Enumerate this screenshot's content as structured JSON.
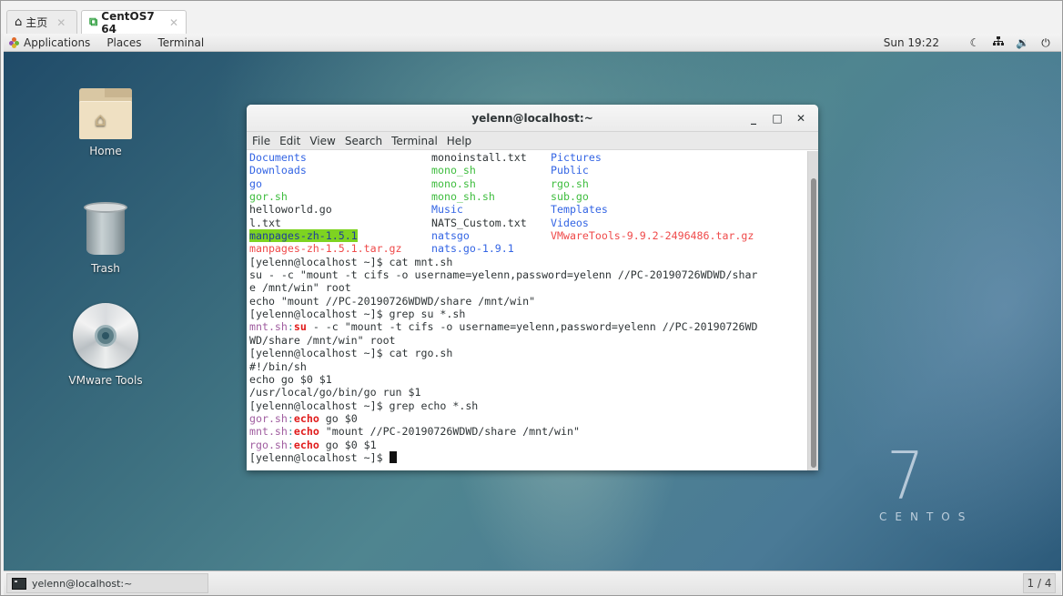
{
  "host_tabs": [
    {
      "icon": "home-icon",
      "label": "主页",
      "active": false
    },
    {
      "icon": "vm-icon",
      "label": "CentOS7 64",
      "active": true
    }
  ],
  "topbar": {
    "menus": [
      "Applications",
      "Places",
      "Terminal"
    ],
    "clock": "Sun 19:22",
    "tray_icons": [
      "night-light-icon",
      "network-icon",
      "volume-icon",
      "power-icon"
    ]
  },
  "desktop_icons": [
    {
      "label": "Home",
      "icon": "home-folder-icon"
    },
    {
      "label": "Trash",
      "icon": "trash-icon"
    },
    {
      "label": "VMware Tools",
      "icon": "disc-icon"
    }
  ],
  "branding": {
    "number": "7",
    "word": "CENTOS"
  },
  "terminal": {
    "title": "yelenn@localhost:~",
    "window_buttons": [
      "minimize",
      "maximize",
      "close"
    ],
    "menu": [
      "File",
      "Edit",
      "View",
      "Search",
      "Terminal",
      "Help"
    ],
    "ls_rows": [
      [
        {
          "t": "Documents",
          "c": "blue"
        },
        {
          "t": "monoinstall.txt",
          "c": ""
        },
        {
          "t": "Pictures",
          "c": "blue"
        }
      ],
      [
        {
          "t": "Downloads",
          "c": "blue"
        },
        {
          "t": "mono_sh",
          "c": "green"
        },
        {
          "t": "Public",
          "c": "blue"
        }
      ],
      [
        {
          "t": "go",
          "c": "blue"
        },
        {
          "t": "mono.sh",
          "c": "green"
        },
        {
          "t": "rgo.sh",
          "c": "green"
        }
      ],
      [
        {
          "t": "gor.sh",
          "c": "green"
        },
        {
          "t": "mono_sh.sh",
          "c": "green"
        },
        {
          "t": "sub.go",
          "c": "green"
        }
      ],
      [
        {
          "t": "helloworld.go",
          "c": ""
        },
        {
          "t": "Music",
          "c": "blue"
        },
        {
          "t": "Templates",
          "c": "blue"
        }
      ],
      [
        {
          "t": "l.txt",
          "c": ""
        },
        {
          "t": "NATS_Custom.txt",
          "c": ""
        },
        {
          "t": "Videos",
          "c": "blue"
        }
      ],
      [
        {
          "t": "manpages-zh-1.5.1",
          "c": "hl"
        },
        {
          "t": "natsgo",
          "c": "blue"
        },
        {
          "t": "VMwareTools-9.9.2-2496486.tar.gz",
          "c": "red"
        }
      ],
      [
        {
          "t": "manpages-zh-1.5.1.tar.gz",
          "c": "red"
        },
        {
          "t": "nats.go-1.9.1",
          "c": "blue"
        },
        {
          "t": "",
          "c": ""
        }
      ]
    ],
    "lines": [
      "[yelenn@localhost ~]$ cat mnt.sh",
      "su - -c \"mount -t cifs -o username=yelenn,password=yelenn //PC-20190726WDWD/shar",
      "e /mnt/win\" root",
      "echo \"mount //PC-20190726WDWD/share /mnt/win\"",
      "[yelenn@localhost ~]$ grep su *.sh"
    ],
    "grep_su": {
      "file": "mnt.sh",
      "sep": ":",
      "match": "su",
      "rest": " - -c \"mount -t cifs -o username=yelenn,password=yelenn //PC-20190726WD",
      "cont": "WD/share /mnt/win\" root"
    },
    "lines2": [
      "[yelenn@localhost ~]$ cat rgo.sh",
      "#!/bin/sh",
      "echo go $0 $1",
      "/usr/local/go/bin/go run $1",
      "[yelenn@localhost ~]$ grep echo *.sh"
    ],
    "grep_echo": [
      {
        "file": "gor.sh",
        "sep": ":",
        "match": "echo",
        "rest": " go $0"
      },
      {
        "file": "mnt.sh",
        "sep": ":",
        "match": "echo",
        "rest": " \"mount //PC-20190726WDWD/share /mnt/win\""
      },
      {
        "file": "rgo.sh",
        "sep": ":",
        "match": "echo",
        "rest": " go $0 $1"
      }
    ],
    "prompt": "[yelenn@localhost ~]$ "
  },
  "taskbar": {
    "window_label": "yelenn@localhost:~",
    "workspace": "1 / 4"
  }
}
